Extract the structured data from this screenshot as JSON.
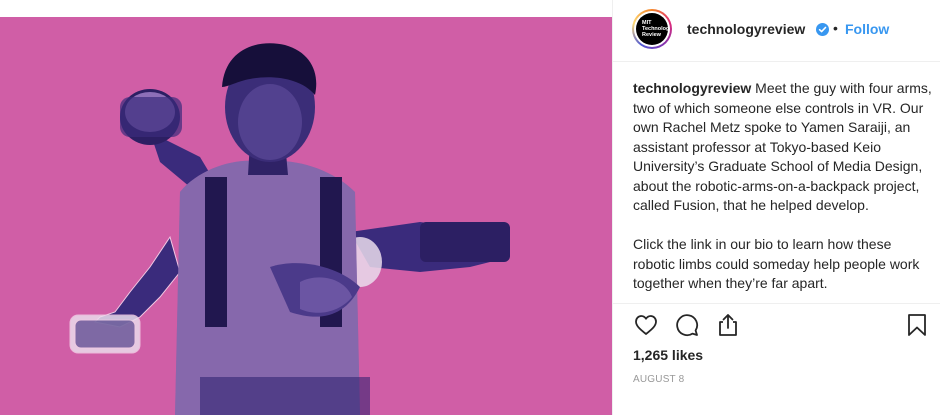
{
  "post": {
    "username": "technologyreview",
    "avatar_text": "MIT\nTechnology\nReview",
    "separator": "•",
    "follow_label": "Follow",
    "caption_paragraph_1": "Meet the guy with four arms, two of which someone else controls in VR. Our own Rachel Metz spoke to Yamen Saraiji, an assistant professor at Tokyo-based Keio University’s Graduate School of Media Design, about the robotic-arms-on-a-backpack project, called Fusion, that he helped develop.",
    "caption_paragraph_2": "Click the link in our bio to learn how these robotic limbs could someday help people work together when they’re far apart.",
    "likes": "1,265 likes",
    "date": "AUGUST 8"
  },
  "icons": {
    "like": "heart-icon",
    "comment": "comment-icon",
    "share": "share-icon",
    "save": "bookmark-icon",
    "verified": "verified-badge-icon"
  },
  "colors": {
    "photo_background": "#d561a8",
    "photo_duotone_dark": "#2a1d6e",
    "link_blue": "#3897f0",
    "verified_blue": "#3897f0",
    "muted_text": "#999999"
  }
}
